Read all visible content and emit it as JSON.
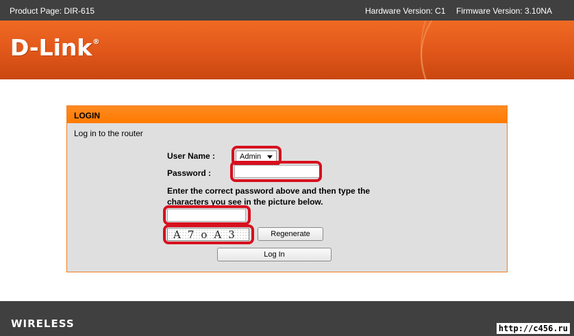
{
  "topbar": {
    "product": "Product Page: DIR-615",
    "hardware": "Hardware Version: C1",
    "firmware": "Firmware Version: 3.10NA"
  },
  "brand": {
    "logo": "D-Link",
    "reg_mark": "®"
  },
  "login": {
    "header": "LOGIN",
    "subtitle": "Log in to the router",
    "username_label": "User Name :",
    "username_selected": "Admin",
    "password_label": "Password :",
    "password_value": "",
    "instructions": "Enter the correct password above and then type the characters you see in the picture below.",
    "captcha_input_value": "",
    "captcha_text": "A7oA3",
    "regenerate_label": "Regenerate",
    "login_button_label": "Log In"
  },
  "footer": {
    "brand_text": "WIRELESS"
  },
  "watermark": "http://c456.ru",
  "colors": {
    "topbar": "#404040",
    "banner": "#e0561a",
    "login_header": "#ff7a00",
    "panel": "#dfdfdf",
    "highlight": "#d7101e"
  },
  "icons": {
    "dropdown": "chevron-down-icon"
  }
}
